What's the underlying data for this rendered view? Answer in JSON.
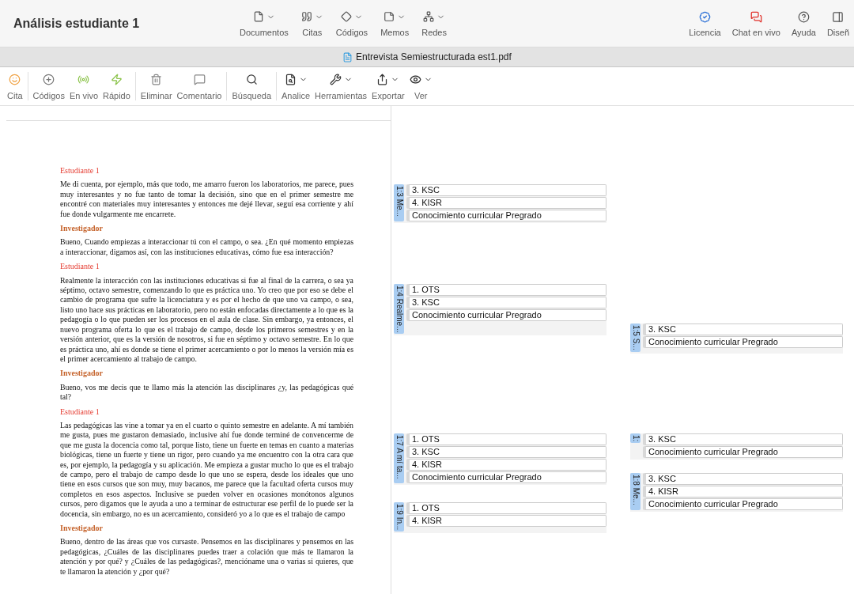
{
  "window": {
    "title": "Análisis estudiante 1"
  },
  "nav": [
    {
      "label": "Documentos"
    },
    {
      "label": "Citas"
    },
    {
      "label": "Códigos"
    },
    {
      "label": "Memos"
    },
    {
      "label": "Redes"
    }
  ],
  "actions": [
    {
      "label": "Licencia"
    },
    {
      "label": "Chat en vivo"
    },
    {
      "label": "Ayuda"
    },
    {
      "label": "Diseñ"
    }
  ],
  "tab": {
    "label": "Entrevista Semiestructurada est1.pdf"
  },
  "toolbar": [
    {
      "label": "Cita",
      "caret": false
    },
    {
      "label": "Códigos",
      "caret": false
    },
    {
      "label": "En vivo",
      "caret": false
    },
    {
      "label": "Rápido",
      "caret": false
    },
    {
      "label": "Eliminar",
      "caret": false
    },
    {
      "label": "Comentario",
      "caret": false
    },
    {
      "label": "Búsqueda",
      "caret": false
    },
    {
      "label": "Analice",
      "caret": true
    },
    {
      "label": "Herramientas",
      "caret": true
    },
    {
      "label": "Exportar",
      "caret": true
    },
    {
      "label": "Ver",
      "caret": true
    }
  ],
  "document": {
    "blocks": [
      {
        "kind": "student",
        "text": "Estudiante 1"
      },
      {
        "kind": "paragraph",
        "text": "Me di cuenta, por ejemplo, más que todo, me amarro fueron los laboratorios, me parece, pues muy interesantes y no fue tanto de tomar la decisión, sino que en el primer semestre me encontré con materiales muy interesantes y entonces me dejé llevar, seguí esa corriente y ahí fue donde vulgarmente me encarrete."
      },
      {
        "kind": "researcher",
        "text": "Investigador"
      },
      {
        "kind": "paragraph",
        "text": "Bueno, Cuando empiezas a interaccionar tú con el campo, o sea. ¿En qué momento empiezas a interaccionar, digamos así, con las instituciones educativas, cómo fue esa interacción?"
      },
      {
        "kind": "student",
        "text": "Estudiante 1"
      },
      {
        "kind": "paragraph",
        "text": "Realmente la interacción con las instituciones educativas si fue al final de la carrera, o sea ya séptimo, octavo semestre, comenzando lo que es práctica uno. Yo creo que por eso se debe el cambio de programa que sufre la licenciatura y es por el hecho de que uno va campo, o sea, listo uno hace sus prácticas en laboratorio, pero no están enfocadas directamente a lo que es la pedagogía o lo que pueden ser los procesos en el aula de clase. Sin embargo, ya entonces, el nuevo programa oferta lo que es el trabajo de campo, desde los primeros semestres y en la versión anterior, que es la versión de nosotros, si fue en séptimo y octavo semestre. En lo que es práctica uno, ahí es donde se tiene el primer acercamiento o por lo menos la versión mía es el primer acercamiento al trabajo de campo."
      },
      {
        "kind": "researcher",
        "text": "Investigador"
      },
      {
        "kind": "paragraph",
        "text": "Bueno, vos me decis que te llamo más la atención las disciplinares ¿y, las pedagógicas qué tal?"
      },
      {
        "kind": "student",
        "text": "Estudiante 1"
      },
      {
        "kind": "paragraph",
        "text": "Las pedagógicas las vine a tomar ya en el cuarto o quinto semestre en adelante. A mí también me gusta, pues me gustaron demasiado, inclusive ahí fue donde terminé de convencerme de que me gusta la docencia como tal, porque listo, tiene un fuerte en temas en cuanto a materias biológicas, tiene un fuerte y tiene un rigor, pero cuando ya me encuentro con la otra cara que es, por ejemplo, la pedagogía y su aplicación.  Me empieza a gustar mucho lo que es el trabajo de campo, pero el trabajo de campo desde lo que uno se espera, desde los ideales que uno tiene en esos cursos que son muy, muy bacanos, me parece que la facultad oferta cursos muy completos en esos aspectos. Inclusive se pueden volver en ocasiones monótonos algunos cursos, pero digamos que le ayuda a uno a terminar de estructurar ese perfil de lo puede ser la docencia, sin embargo, no es un acercamiento, consideró yo a lo que es el trabajo de campo"
      },
      {
        "kind": "researcher",
        "text": "Investigador"
      },
      {
        "kind": "paragraph",
        "text": "Bueno, dentro de las áreas que vos cursaste. Pensemos en las disciplinares y pensemos en las pedagógicas, ¿Cuáles de las disciplinares puedes traer a colación que más te llamaron la atención y por qué? y ¿Cuáles de las pedagógicas?, mencióname una o varias si quieres, que te llamaron la atención y ¿por qué?"
      }
    ]
  },
  "margin": {
    "quotations": [
      {
        "label": "1:3 Me...",
        "codes": [
          "3. KSC",
          "4. KISR",
          "Conocimiento curricular Pregrado"
        ]
      },
      {
        "label": "1:4 Realme...",
        "codes": [
          "1. OTS",
          "3. KSC",
          "Conocimiento curricular Pregrado"
        ]
      },
      {
        "label": "1:5 S...",
        "codes": [
          "3. KSC",
          "Conocimiento curricular Pregrado"
        ]
      },
      {
        "label": "1:7 A mí ta...",
        "codes": [
          "1. OTS",
          "3. KSC",
          "4. KISR",
          "Conocimiento curricular Pregrado"
        ]
      },
      {
        "label": "1:",
        "codes": [
          "3. KSC",
          "Conocimiento curricular Pregrado"
        ]
      },
      {
        "label": "1:8 Me...",
        "codes": [
          "3. KSC",
          "4. KISR",
          "Conocimiento curricular Pregrado"
        ]
      },
      {
        "label": "1:9 In...",
        "codes": [
          "1. OTS",
          "4. KISR"
        ]
      }
    ]
  }
}
